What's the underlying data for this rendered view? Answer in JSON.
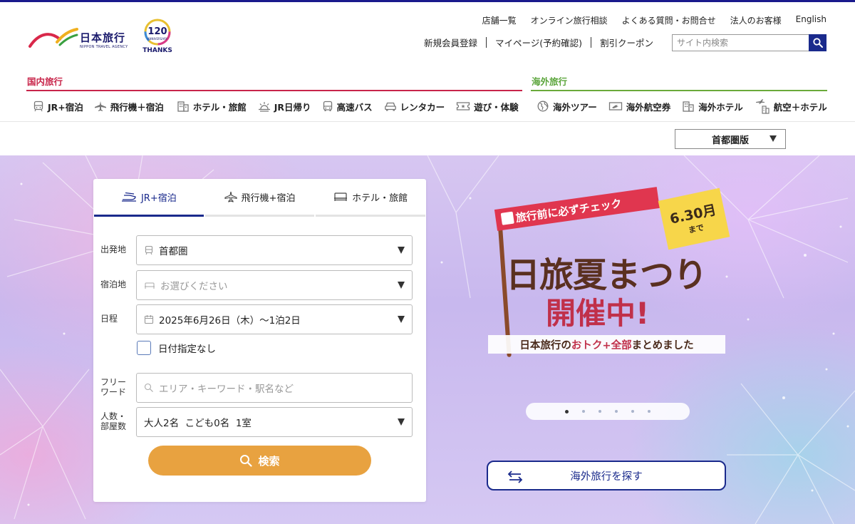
{
  "brand": {
    "logo_jp": "日本旅行",
    "logo_en": "NIPPON TRAVEL AGENCY",
    "anniversary_number": "120",
    "anniversary_sub": "ANNIVERSARY",
    "anniversary_thanks": "THANKS"
  },
  "utility_links": [
    "店舗一覧",
    "オンライン旅行相談",
    "よくある質問・お問合せ",
    "法人のお客様",
    "English"
  ],
  "account_links": [
    "新規会員登録",
    "マイページ(予約確認)",
    "割引クーポン"
  ],
  "site_search": {
    "placeholder": "サイト内検索"
  },
  "categories": {
    "domestic": "国内旅行",
    "overseas": "海外旅行"
  },
  "nav_domestic": [
    {
      "label": "JR+宿泊",
      "icon": "train-icon"
    },
    {
      "label": "飛行機＋宿泊",
      "icon": "airplane-icon"
    },
    {
      "label": "ホテル・旅館",
      "icon": "hotel-icon"
    },
    {
      "label": "JR日帰り",
      "icon": "sunrise-icon"
    },
    {
      "label": "高速バス",
      "icon": "bus-icon"
    },
    {
      "label": "レンタカー",
      "icon": "car-icon"
    },
    {
      "label": "遊び・体験",
      "icon": "ticket-icon"
    }
  ],
  "nav_overseas": [
    {
      "label": "海外ツアー",
      "icon": "globe-icon"
    },
    {
      "label": "海外航空券",
      "icon": "air-ticket-icon"
    },
    {
      "label": "海外ホテル",
      "icon": "hotel-icon"
    },
    {
      "label": "航空＋ホテル",
      "icon": "plane-hotel-icon"
    }
  ],
  "region_selector": {
    "value": "首都圏版"
  },
  "search_panel": {
    "tabs": [
      {
        "label": "JR+宿泊",
        "active": true
      },
      {
        "label": "飛行機+宿泊",
        "active": false
      },
      {
        "label": "ホテル・旅館",
        "active": false
      }
    ],
    "departure": {
      "label": "出発地",
      "value": "首都圏"
    },
    "destination": {
      "label": "宿泊地",
      "placeholder": "お選びください"
    },
    "date": {
      "label": "日程",
      "value": "2025年6月26日（木）～1泊2日"
    },
    "no_date": {
      "label": "日付指定なし",
      "checked": false
    },
    "freeword": {
      "label_line1": "フリー",
      "label_line2": "ワード",
      "placeholder": "エリア・キーワード・駅名など"
    },
    "guests": {
      "label_line1": "人数・",
      "label_line2": "部屋数",
      "value": "大人2名  こども0名  1室"
    },
    "submit_label": "検索"
  },
  "banner": {
    "tag": "旅行前に必ずチェック",
    "date_main": "6.30",
    "date_day": "月",
    "date_until": "まで",
    "title_line1": "日旅夏まつり",
    "title_line2": "開催中!",
    "sub_a": "日本旅行の",
    "sub_b": "おトク+全部",
    "sub_c": "まとめました"
  },
  "carousel": {
    "total": 6,
    "active_index": 0
  },
  "overseas_button": {
    "label": "海外旅行を探す"
  },
  "colors": {
    "brand_navy": "#1a2a8c",
    "domestic_red": "#c8254a",
    "overseas_green": "#5ba53b",
    "search_orange": "#e8a240"
  }
}
